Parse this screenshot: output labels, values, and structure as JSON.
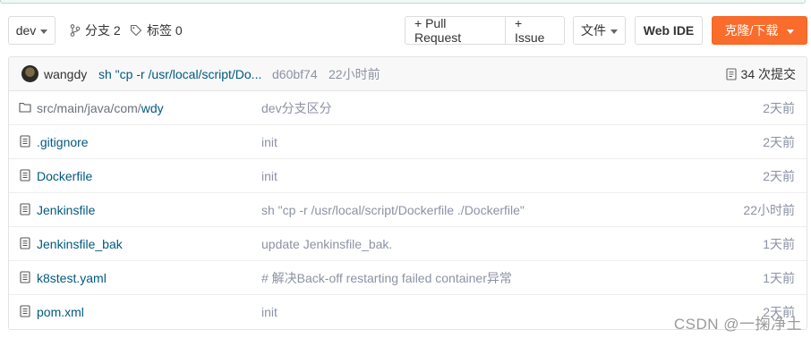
{
  "branch_selector": {
    "label": "dev"
  },
  "branches": {
    "label": "分支 2"
  },
  "tags": {
    "label": "标签 0"
  },
  "actions": {
    "pull_request": "+ Pull Request",
    "issue": "+ Issue",
    "file": "文件",
    "web_ide": "Web IDE",
    "clone": "克隆/下载"
  },
  "latest_commit": {
    "author": "wangdy",
    "message": "sh \"cp -r /usr/local/script/Do...",
    "sha": "d60bf74",
    "time": "22小时前",
    "count_label": "34 次提交"
  },
  "files": [
    {
      "type": "folder",
      "prefix": "src/main/java/com/",
      "name": "wdy",
      "message": "dev分支区分",
      "time": "2天前"
    },
    {
      "type": "file",
      "prefix": "",
      "name": ".gitignore",
      "message": "init",
      "time": "2天前"
    },
    {
      "type": "file",
      "prefix": "",
      "name": "Dockerfile",
      "message": "init",
      "time": "2天前"
    },
    {
      "type": "file",
      "prefix": "",
      "name": "Jenkinsfile",
      "message": "sh \"cp -r /usr/local/script/Dockerfile ./Dockerfile\"",
      "time": "22小时前"
    },
    {
      "type": "file",
      "prefix": "",
      "name": "Jenkinsfile_bak",
      "message": "update Jenkinsfile_bak.",
      "time": "1天前"
    },
    {
      "type": "file",
      "prefix": "",
      "name": "k8stest.yaml",
      "message": "# 解决Back-off restarting failed container异常",
      "time": "1天前"
    },
    {
      "type": "file",
      "prefix": "",
      "name": "pom.xml",
      "message": "init",
      "time": "2天前"
    }
  ],
  "watermark": "CSDN @一掬净土",
  "colors": {
    "accent": "#fa6c2b",
    "link": "#005980",
    "muted": "#8c92a4"
  }
}
